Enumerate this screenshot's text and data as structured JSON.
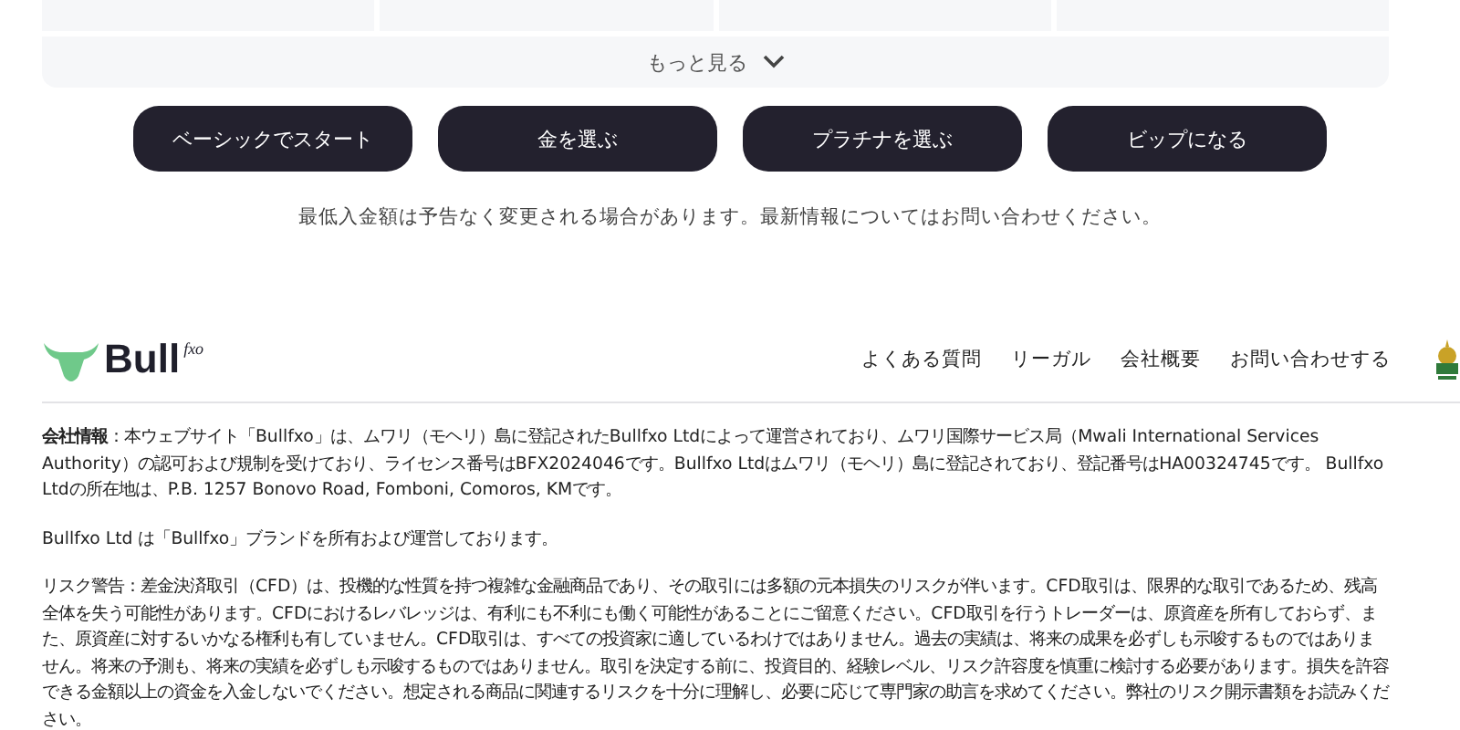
{
  "plan_table": {
    "more_label": "もっと見る"
  },
  "buttons": [
    {
      "label": "ベーシックでスタート"
    },
    {
      "label": "金を選ぶ"
    },
    {
      "label": "プラチナを選ぶ"
    },
    {
      "label": "ビップになる"
    }
  ],
  "note": "最低入金額は予告なく変更される場合があります。最新情報についてはお問い合わせください。",
  "footer": {
    "logo": {
      "name": "Bull",
      "suffix": "fxo"
    },
    "nav": [
      "よくある質問",
      "リーガル",
      "会社概要",
      "お問い合わせする"
    ],
    "paragraphs": [
      "**会社情報**：本ウェブサイト「Bullfxo」は、ムワリ（モヘリ）島に登記されたBullfxo Ltdによって運営されており、ムワリ国際サービス局（Mwali International Services Authority）の認可および規制を受けており、ライセンス番号はBFX2024046です。Bullfxo Ltdはムワリ（モヘリ）島に登記されており、登記番号はHA00324745です。 Bullfxo Ltdの所在地は、P.B. 1257 Bonovo Road, Fomboni, Comoros, KMです。",
      "Bullfxo Ltd は「Bullfxo」ブランドを所有および運営しております。",
      "リスク警告：差金決済取引（CFD）は、投機的な性質を持つ複雑な金融商品であり、その取引には多額の元本損失のリスクが伴います。CFD取引は、限界的な取引であるため、残高全体を失う可能性があります。CFDにおけるレバレッジは、有利にも不利にも働く可能性があることにご留意ください。CFD取引を行うトレーダーは、原資産を所有しておらず、また、原資産に対するいかなる権利も有していません。CFD取引は、すべての投資家に適しているわけではありません。過去の実績は、将来の成果を必ずしも示唆するものではありません。将来の予測も、将来の実績を必ずしも示唆するものではありません。取引を決定する前に、投資目的、経験レベル、リスク許容度を慎重に検討する必要があります。損失を許容できる金額以上の資金を入金しないでください。想定される商品に関連するリスクを十分に理解し、必要に応じて専門家の助言を求めてください。弊社のリスク開示書類をお読みください。"
    ]
  }
}
